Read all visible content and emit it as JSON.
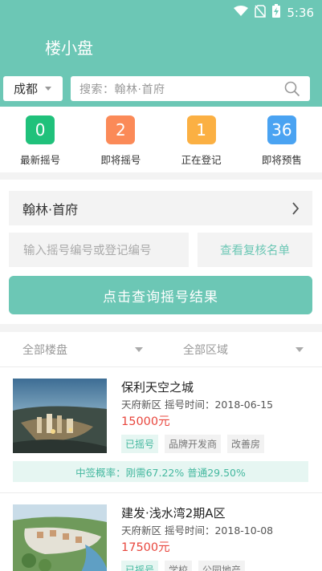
{
  "status_bar": {
    "time": "5:36"
  },
  "header": {
    "title": "楼小盘"
  },
  "city_selector": {
    "value": "成都"
  },
  "search": {
    "placeholder": "搜索：翰林·首府"
  },
  "stats": [
    {
      "count": "0",
      "label": "最新摇号",
      "color": "#20c17b"
    },
    {
      "count": "2",
      "label": "即将摇号",
      "color": "#fb8a58"
    },
    {
      "count": "1",
      "label": "正在登记",
      "color": "#fbb043"
    },
    {
      "count": "36",
      "label": "即将预售",
      "color": "#4aa3f2"
    }
  ],
  "query": {
    "project": "翰林·首府",
    "code_placeholder": "输入摇号编号或登记编号",
    "review_button": "查看复核名单",
    "submit_button": "点击查询摇号结果"
  },
  "filters": {
    "building": "全部楼盘",
    "region": "全部区域"
  },
  "listings": [
    {
      "name": "保利天空之城",
      "meta": "天府新区 摇号时间：2018-06-15",
      "price": "15000元",
      "tags": [
        "已摇号",
        "品牌开发商",
        "改善房"
      ],
      "probability": "中签概率：刚需67.22% 普通29.50%"
    },
    {
      "name": "建发·浅水湾2期A区",
      "meta": "天府新区 摇号时间：2018-10-08",
      "price": "17500元",
      "tags": [
        "已摇号",
        "学校",
        "公园地产"
      ]
    }
  ],
  "colors": {
    "accent": "#6cc7b5",
    "price": "#e8473e"
  }
}
